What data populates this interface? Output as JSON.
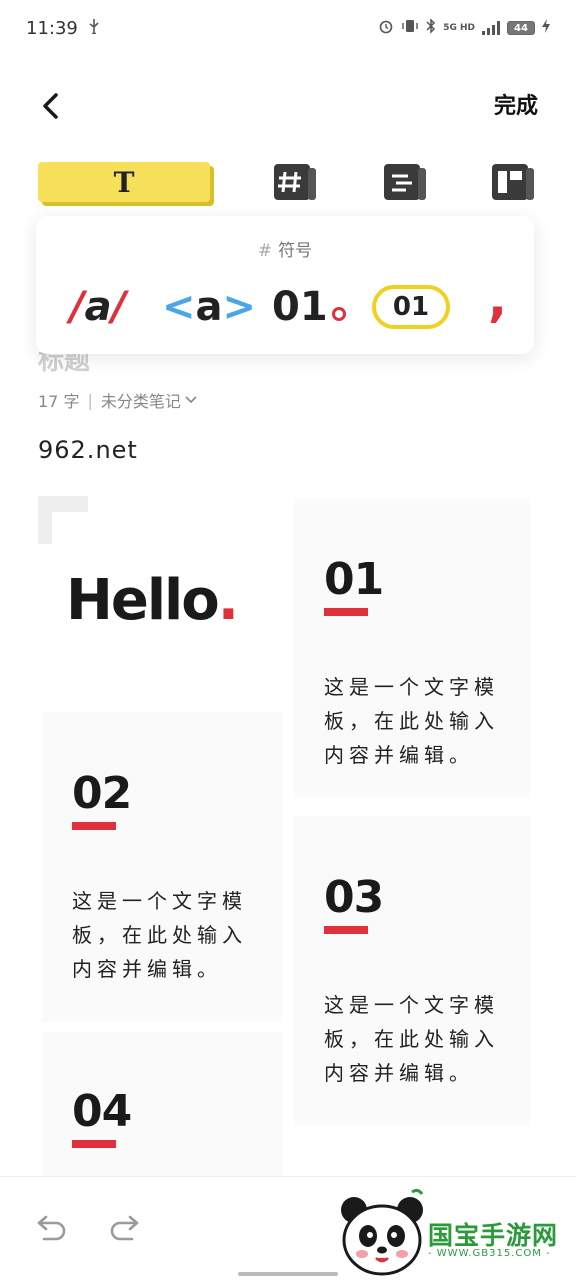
{
  "status_bar": {
    "time": "11:39",
    "network_label": "5G HD",
    "battery": "44"
  },
  "top_bar": {
    "done_label": "完成"
  },
  "toolbar": {
    "text_tool_label": "T"
  },
  "symbols_popup": {
    "hash": "#",
    "title": "符号",
    "items": [
      {
        "slash_left": "/",
        "letter": "a",
        "slash_right": "/"
      },
      {
        "left": "<",
        "letter": "a",
        "right": ">"
      },
      {
        "text": "01"
      },
      {
        "text": "01"
      },
      {
        "text": ","
      }
    ]
  },
  "note": {
    "title_partial": "标题",
    "word_count": "17 字",
    "separator": "|",
    "category": "未分类笔记",
    "body_text": "962.net"
  },
  "template": {
    "hello_word": "Hello",
    "hello_dot": ".",
    "cards": [
      {
        "num": "01",
        "text": "这是一个文字模板，在此处输入内容并编辑。"
      },
      {
        "num": "02",
        "text": "这是一个文字模板，在此处输入内容并编辑。"
      },
      {
        "num": "03",
        "text": "这是一个文字模板，在此处输入内容并编辑。"
      },
      {
        "num": "04"
      }
    ]
  },
  "watermark": {
    "name": "国宝手游网",
    "url": "- WWW.GB315.COM -"
  },
  "colors": {
    "accent_red": "#e0303c",
    "accent_yellow": "#f6e05a",
    "accent_blue": "#4aa6e6",
    "watermark_green": "#2a9a3a"
  }
}
